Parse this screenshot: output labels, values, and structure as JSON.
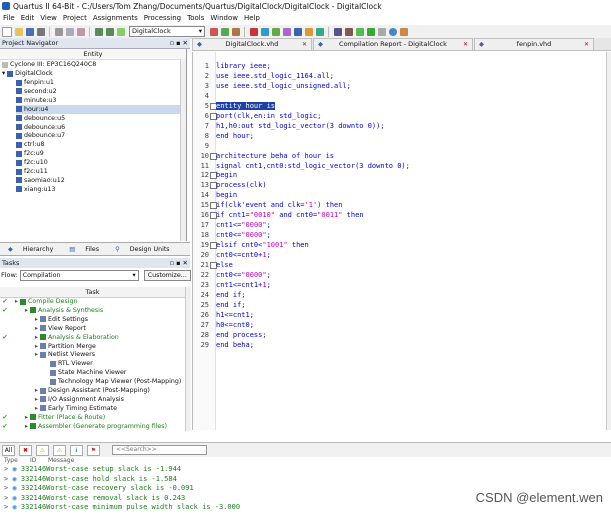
{
  "window": {
    "title": "Quartus II 64-Bit - C:/Users/Tom Zhang/Documents/Quartus/DigitalClock/DigitalClock - DigitalClock"
  },
  "menu": [
    "File",
    "Edit",
    "View",
    "Project",
    "Assignments",
    "Processing",
    "Tools",
    "Window",
    "Help"
  ],
  "toolbar": {
    "entity_selector": "DigitalClock"
  },
  "doc_tabs": [
    {
      "label": "DigitalClock.vhd",
      "active": false
    },
    {
      "label": "Compilation Report - DigitalClock",
      "active": false
    },
    {
      "label": "fenpin.vhd",
      "active": false
    }
  ],
  "project_navigator": {
    "title": "Project Navigator",
    "column_header": "Entity",
    "device": "Cyclone III: EP3C16Q240C8",
    "root": "DigitalClock",
    "items": [
      {
        "label": "fenpin:u1",
        "selected": false
      },
      {
        "label": "second:u2",
        "selected": false
      },
      {
        "label": "minute:u3",
        "selected": false
      },
      {
        "label": "hour:u4",
        "selected": true
      },
      {
        "label": "debounce:u5",
        "selected": false
      },
      {
        "label": "debounce:u6",
        "selected": false
      },
      {
        "label": "debounce:u7",
        "selected": false
      },
      {
        "label": "ctrl:u8",
        "selected": false
      },
      {
        "label": "f2c:u9",
        "selected": false
      },
      {
        "label": "f2c:u10",
        "selected": false
      },
      {
        "label": "f2c:u11",
        "selected": false
      },
      {
        "label": "saomiao:u12",
        "selected": false
      },
      {
        "label": "xiang:u13",
        "selected": false
      }
    ],
    "tabs": [
      "Hierarchy",
      "Files",
      "Design Units"
    ]
  },
  "tasks": {
    "title": "Tasks",
    "flow_label": "Flow:",
    "flow_value": "Compilation",
    "customize_label": "Customize...",
    "column_header": "Task",
    "items": [
      {
        "label": "Compile Design",
        "indent": 0,
        "check": true,
        "green": true
      },
      {
        "label": "Analysis & Synthesis",
        "indent": 1,
        "check": true,
        "green": true
      },
      {
        "label": "Edit Settings",
        "indent": 2,
        "check": false,
        "green": false
      },
      {
        "label": "View Report",
        "indent": 2,
        "check": false,
        "green": false
      },
      {
        "label": "Analysis & Elaboration",
        "indent": 2,
        "check": true,
        "green": true
      },
      {
        "label": "Partition Merge",
        "indent": 2,
        "check": false,
        "green": false
      },
      {
        "label": "Netlist Viewers",
        "indent": 2,
        "check": false,
        "green": false
      },
      {
        "label": "RTL Viewer",
        "indent": 3,
        "check": false,
        "green": false
      },
      {
        "label": "State Machine Viewer",
        "indent": 3,
        "check": false,
        "green": false
      },
      {
        "label": "Technology Map Viewer (Post-Mapping)",
        "indent": 3,
        "check": false,
        "green": false
      },
      {
        "label": "Design Assistant (Post-Mapping)",
        "indent": 2,
        "check": false,
        "green": false
      },
      {
        "label": "I/O Assignment Analysis",
        "indent": 2,
        "check": false,
        "green": false
      },
      {
        "label": "Early Timing Estimate",
        "indent": 2,
        "check": false,
        "green": false
      },
      {
        "label": "Fitter (Place & Route)",
        "indent": 1,
        "check": true,
        "green": true
      },
      {
        "label": "Assembler (Generate programming files)",
        "indent": 1,
        "check": true,
        "green": true
      }
    ]
  },
  "editor": {
    "lines": [
      {
        "n": "1",
        "segs": [
          {
            "t": "library ieee;",
            "c": "kw"
          }
        ]
      },
      {
        "n": "2",
        "segs": [
          {
            "t": "use ieee.std_logic_1164.all;",
            "c": "kw"
          }
        ]
      },
      {
        "n": "3",
        "segs": [
          {
            "t": "use ieee.std_logic_unsigned.all;",
            "c": "kw"
          }
        ]
      },
      {
        "n": "4",
        "segs": []
      },
      {
        "n": "5",
        "segs": [
          {
            "t": "entity hour is",
            "c": "sel"
          }
        ]
      },
      {
        "n": "6",
        "segs": [
          {
            "t": "port(clk,en:in std_logic;",
            "c": "kw"
          }
        ]
      },
      {
        "n": "7",
        "segs": [
          {
            "t": "h1,h0:out std_logic_vector(3 downto 0));",
            "c": "kw"
          }
        ]
      },
      {
        "n": "8",
        "segs": [
          {
            "t": "end hour;",
            "c": "kw"
          }
        ]
      },
      {
        "n": "9",
        "segs": []
      },
      {
        "n": "10",
        "segs": [
          {
            "t": "architecture beha of hour is",
            "c": "kw"
          }
        ]
      },
      {
        "n": "11",
        "segs": [
          {
            "t": "signal cnt1,cnt0:std_logic_vector(3 downto 0);",
            "c": "kw"
          }
        ]
      },
      {
        "n": "12",
        "segs": [
          {
            "t": "begin",
            "c": "kw"
          }
        ]
      },
      {
        "n": "13",
        "segs": [
          {
            "t": "process(clk)",
            "c": "kw"
          }
        ]
      },
      {
        "n": "14",
        "segs": [
          {
            "t": "begin",
            "c": "kw"
          }
        ]
      },
      {
        "n": "15",
        "segs": [
          {
            "t": "if(clk'event and clk=",
            "c": "kw"
          },
          {
            "t": "'1'",
            "c": "str"
          },
          {
            "t": ") then",
            "c": "kw"
          }
        ]
      },
      {
        "n": "16",
        "segs": [
          {
            "t": "if cnt1=",
            "c": "kw"
          },
          {
            "t": "\"0010\"",
            "c": "str"
          },
          {
            "t": " and cnt0=",
            "c": "kw"
          },
          {
            "t": "\"0011\"",
            "c": "str"
          },
          {
            "t": " then",
            "c": "kw"
          }
        ]
      },
      {
        "n": "17",
        "segs": [
          {
            "t": "cnt1<=",
            "c": "kw"
          },
          {
            "t": "\"0000\"",
            "c": "str"
          },
          {
            "t": ";",
            "c": "kw"
          }
        ]
      },
      {
        "n": "18",
        "segs": [
          {
            "t": "cnt0<=",
            "c": "kw"
          },
          {
            "t": "\"0000\"",
            "c": "str"
          },
          {
            "t": ";",
            "c": "kw"
          }
        ]
      },
      {
        "n": "19",
        "segs": [
          {
            "t": "elsif cnt0<",
            "c": "kw"
          },
          {
            "t": "\"1001\"",
            "c": "str"
          },
          {
            "t": " then",
            "c": "kw"
          }
        ]
      },
      {
        "n": "20",
        "segs": [
          {
            "t": "cnt0<=cnt0+",
            "c": "kw"
          },
          {
            "t": "1",
            "c": "str"
          },
          {
            "t": ";",
            "c": "kw"
          }
        ]
      },
      {
        "n": "21",
        "segs": [
          {
            "t": "else",
            "c": "kw"
          }
        ]
      },
      {
        "n": "22",
        "segs": [
          {
            "t": "cnt0<=",
            "c": "kw"
          },
          {
            "t": "\"0000\"",
            "c": "str"
          },
          {
            "t": ";",
            "c": "kw"
          }
        ]
      },
      {
        "n": "23",
        "segs": [
          {
            "t": "cnt1<=cnt1+",
            "c": "kw"
          },
          {
            "t": "1",
            "c": "str"
          },
          {
            "t": ";",
            "c": "kw"
          }
        ]
      },
      {
        "n": "24",
        "segs": [
          {
            "t": "end if;",
            "c": "kw"
          }
        ]
      },
      {
        "n": "25",
        "segs": [
          {
            "t": "end if;",
            "c": "kw"
          }
        ]
      },
      {
        "n": "26",
        "segs": [
          {
            "t": "h1<=cnt1;",
            "c": "kw"
          }
        ]
      },
      {
        "n": "27",
        "segs": [
          {
            "t": "h0<=cnt0;",
            "c": "kw"
          }
        ]
      },
      {
        "n": "28",
        "segs": [
          {
            "t": "end process;",
            "c": "kw"
          }
        ]
      },
      {
        "n": "29",
        "segs": [
          {
            "t": "end beha;",
            "c": "kw"
          }
        ]
      }
    ]
  },
  "messages": {
    "filter_all": "All",
    "search_placeholder": "<<Search>>",
    "columns": [
      "Type",
      "ID",
      "Message"
    ],
    "rows": [
      {
        "id": "332146",
        "text": "Worst-case setup slack is -1.944"
      },
      {
        "id": "332146",
        "text": "Worst-case hold slack is -1.584"
      },
      {
        "id": "332146",
        "text": "Worst-case recovery slack is -0.091"
      },
      {
        "id": "332146",
        "text": "Worst-case removal slack is 0.243"
      },
      {
        "id": "332146",
        "text": "Worst-case minimum pulse width slack is -3.000"
      }
    ]
  },
  "watermark": "CSDN @element.wen",
  "colors": {
    "keyword": "#0000e6",
    "string": "#c000c0",
    "selection": "#1f3fa8",
    "message_green": "#1b7f1b"
  }
}
